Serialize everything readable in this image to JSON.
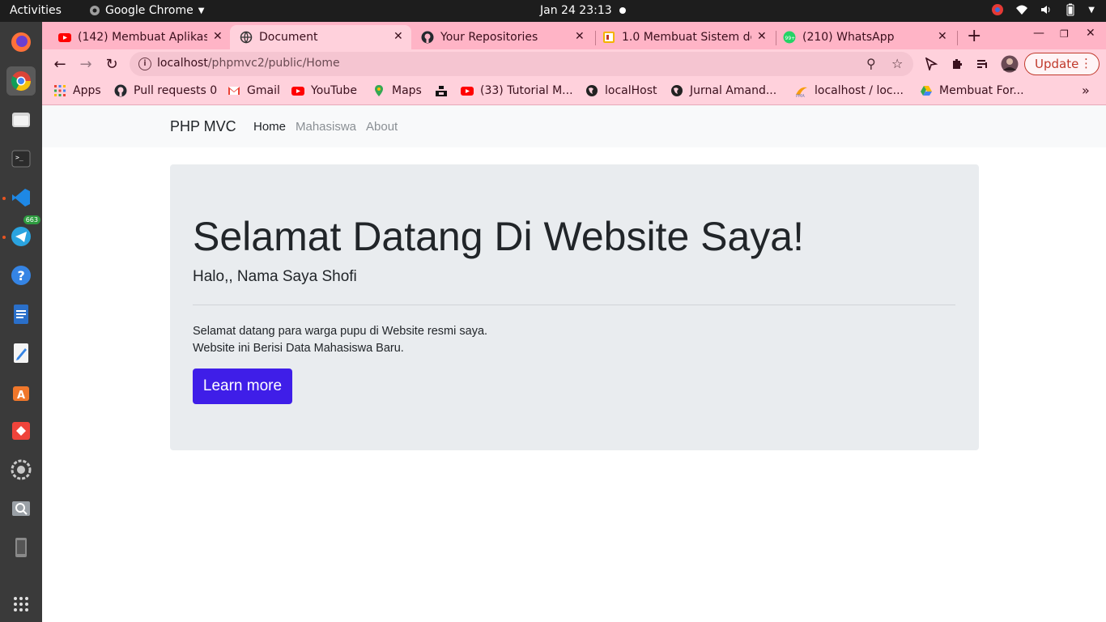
{
  "system": {
    "activities": "Activities",
    "app_name": "Google Chrome",
    "clock": "Jan 24  23:13"
  },
  "dock": {
    "telegram_badge": "663"
  },
  "browser": {
    "tabs": [
      {
        "title": "(142) Membuat Aplikasi",
        "icon": "youtube-icon"
      },
      {
        "title": "Document",
        "icon": "globe-icon"
      },
      {
        "title": "Your Repositories",
        "icon": "github-icon"
      },
      {
        "title": "1.0 Membuat Sistem de",
        "icon": "slides-icon"
      },
      {
        "title": "(210) WhatsApp",
        "icon": "whatsapp-icon"
      }
    ],
    "address": {
      "host": "localhost",
      "path": "/phpmvc2/public/Home"
    },
    "update_label": "Update",
    "bookmarks": [
      {
        "label": "Apps",
        "icon": "apps-grid-icon"
      },
      {
        "label": "Pull requests 0",
        "icon": "github-icon"
      },
      {
        "label": "Gmail",
        "icon": "gmail-icon"
      },
      {
        "label": "YouTube",
        "icon": "youtube-icon"
      },
      {
        "label": "Maps",
        "icon": "maps-icon"
      },
      {
        "label": "",
        "icon": "unsplash-icon"
      },
      {
        "label": "(33) Tutorial M...",
        "icon": "youtube-icon"
      },
      {
        "label": "localHost",
        "icon": "globe-icon"
      },
      {
        "label": "Jurnal Amand...",
        "icon": "globe-icon"
      },
      {
        "label": "localhost / loc...",
        "icon": "phpmyadmin-icon"
      },
      {
        "label": "Membuat For...",
        "icon": "drive-icon"
      }
    ],
    "more_bookmarks": "»"
  },
  "page": {
    "navbar": {
      "brand": "PHP MVC",
      "links": [
        "Home",
        "Mahasiswa",
        "About"
      ],
      "active": "Home"
    },
    "jumbotron": {
      "heading": "Selamat Datang Di Website Saya!",
      "lead": "Halo,, Nama Saya Shofi",
      "line1": "Selamat datang para warga pupu di Website resmi saya.",
      "line2": "Website ini Berisi Data Mahasiswa Baru.",
      "button": "Learn more"
    }
  },
  "colors": {
    "tabstrip": "#ffb4c6",
    "toolbar": "#ffd1dc",
    "primary_button": "#3f1ee8",
    "jumbotron_bg": "#e9ecef"
  }
}
